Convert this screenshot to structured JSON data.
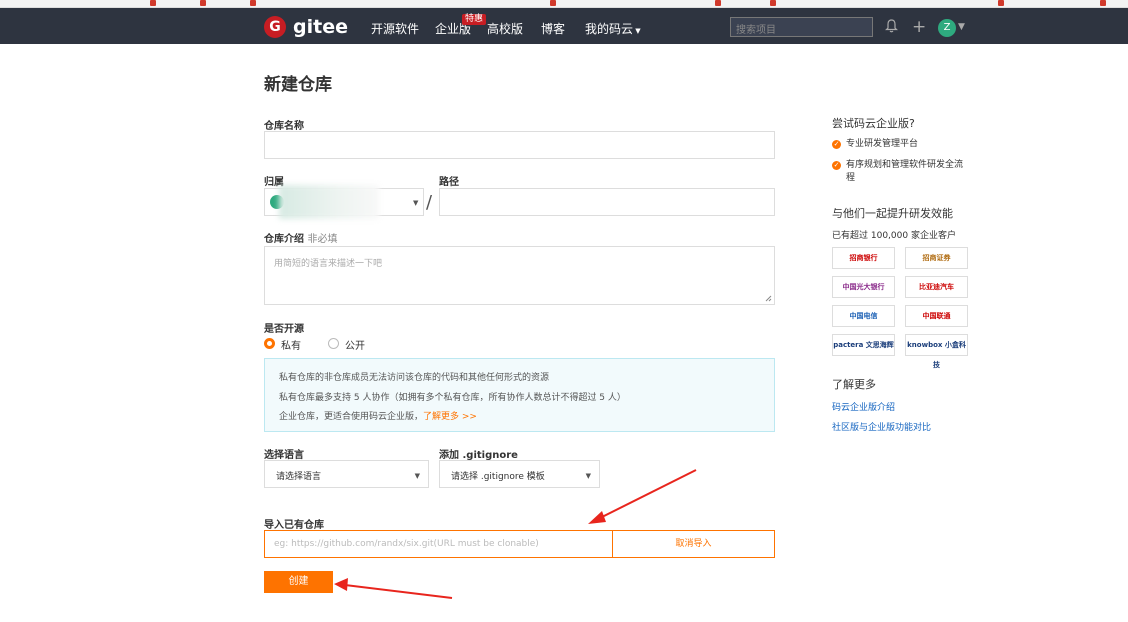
{
  "topnav": {
    "logo_char": "G",
    "logo_text": "gitee",
    "nav": [
      "开源软件",
      "企业版",
      "高校版",
      "博客",
      "我的码云"
    ],
    "hot_badge": "特惠",
    "search_placeholder": "搜索项目",
    "avatar_letter": "Z"
  },
  "page": {
    "title": "新建仓库"
  },
  "form": {
    "name_label": "仓库名称",
    "owner_label": "归属",
    "path_label": "路径",
    "slash": "/",
    "desc_label": "仓库介绍",
    "desc_optional": "非必填",
    "desc_placeholder": "用简短的语言来描述一下吧",
    "visibility_label": "是否开源",
    "private_label": "私有",
    "public_label": "公开",
    "selected_visibility": "私有",
    "info_lines": [
      "私有仓库的非仓库成员无法访问该仓库的代码和其他任何形式的资源",
      "私有仓库最多支持 5 人协作（如拥有多个私有仓库，所有协作人数总计不得超过 5 人）",
      "企业仓库，更适合使用码云企业版，"
    ],
    "info_link": "了解更多 >>",
    "lang_label": "选择语言",
    "lang_value": "请选择语言",
    "gitignore_label": "添加 .gitignore",
    "gitignore_value": "请选择 .gitignore 模板",
    "import_label": "导入已有仓库",
    "import_placeholder": "eg: https://github.com/randx/six.git(URL must be clonable)",
    "cancel_import": "取消导入",
    "create": "创建"
  },
  "sidebar": {
    "trial_title": "尝试码云企业版?",
    "features": [
      "专业研发管理平台",
      "有序规划和管理软件研发全流程"
    ],
    "boost_title": "与他们一起提升研发效能",
    "customers_text": "已有超过 100,000 家企业客户",
    "logos": [
      "招商银行",
      "招商证券",
      "中国光大银行",
      "比亚迪汽车",
      "中国电信",
      "中国联通",
      "pactera 文思海辉",
      "knowbox 小盒科技"
    ],
    "more_title": "了解更多",
    "links": [
      "码云企业版介绍",
      "社区版与企业版功能对比"
    ]
  },
  "colors": {
    "accent": "#fe7300",
    "nav_bg": "#2e3440",
    "brand_red": "#c71d23",
    "annotation_red": "#e8251d"
  }
}
